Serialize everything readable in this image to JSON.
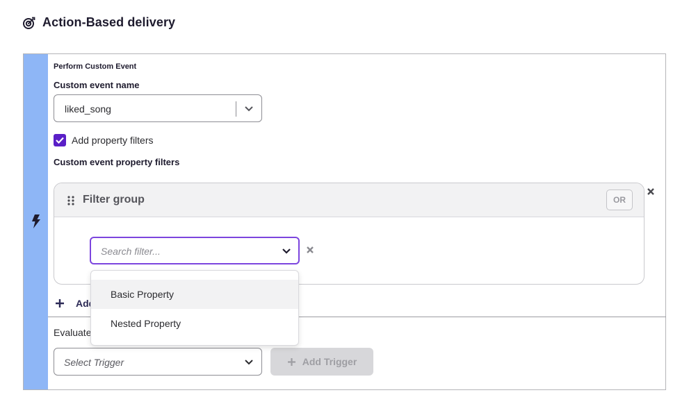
{
  "heading": {
    "title": "Action-Based delivery",
    "icon": "target-icon"
  },
  "trigger_card": {
    "accent_color": "#8eb6f6",
    "icon": "lightning-bolt-icon",
    "action_type": "Perform Custom Event",
    "event_name_label": "Custom event name",
    "event_name_value": "liked_song",
    "property_filters_checkbox": {
      "label": "Add property filters",
      "checked": true
    },
    "property_filters_label": "Custom event property filters",
    "filter_group": {
      "title": "Filter group",
      "or_label": "OR",
      "search_placeholder": "Search filter...",
      "dropdown_options": [
        "Basic Property",
        "Nested Property"
      ]
    },
    "add_group_label": "Add",
    "evaluate_label": "Evaluate",
    "select_trigger_placeholder": "Select Trigger",
    "add_trigger_label": "Add Trigger"
  },
  "colors": {
    "accent_purple": "#5a1fc7",
    "focus_border": "#7c45de"
  }
}
